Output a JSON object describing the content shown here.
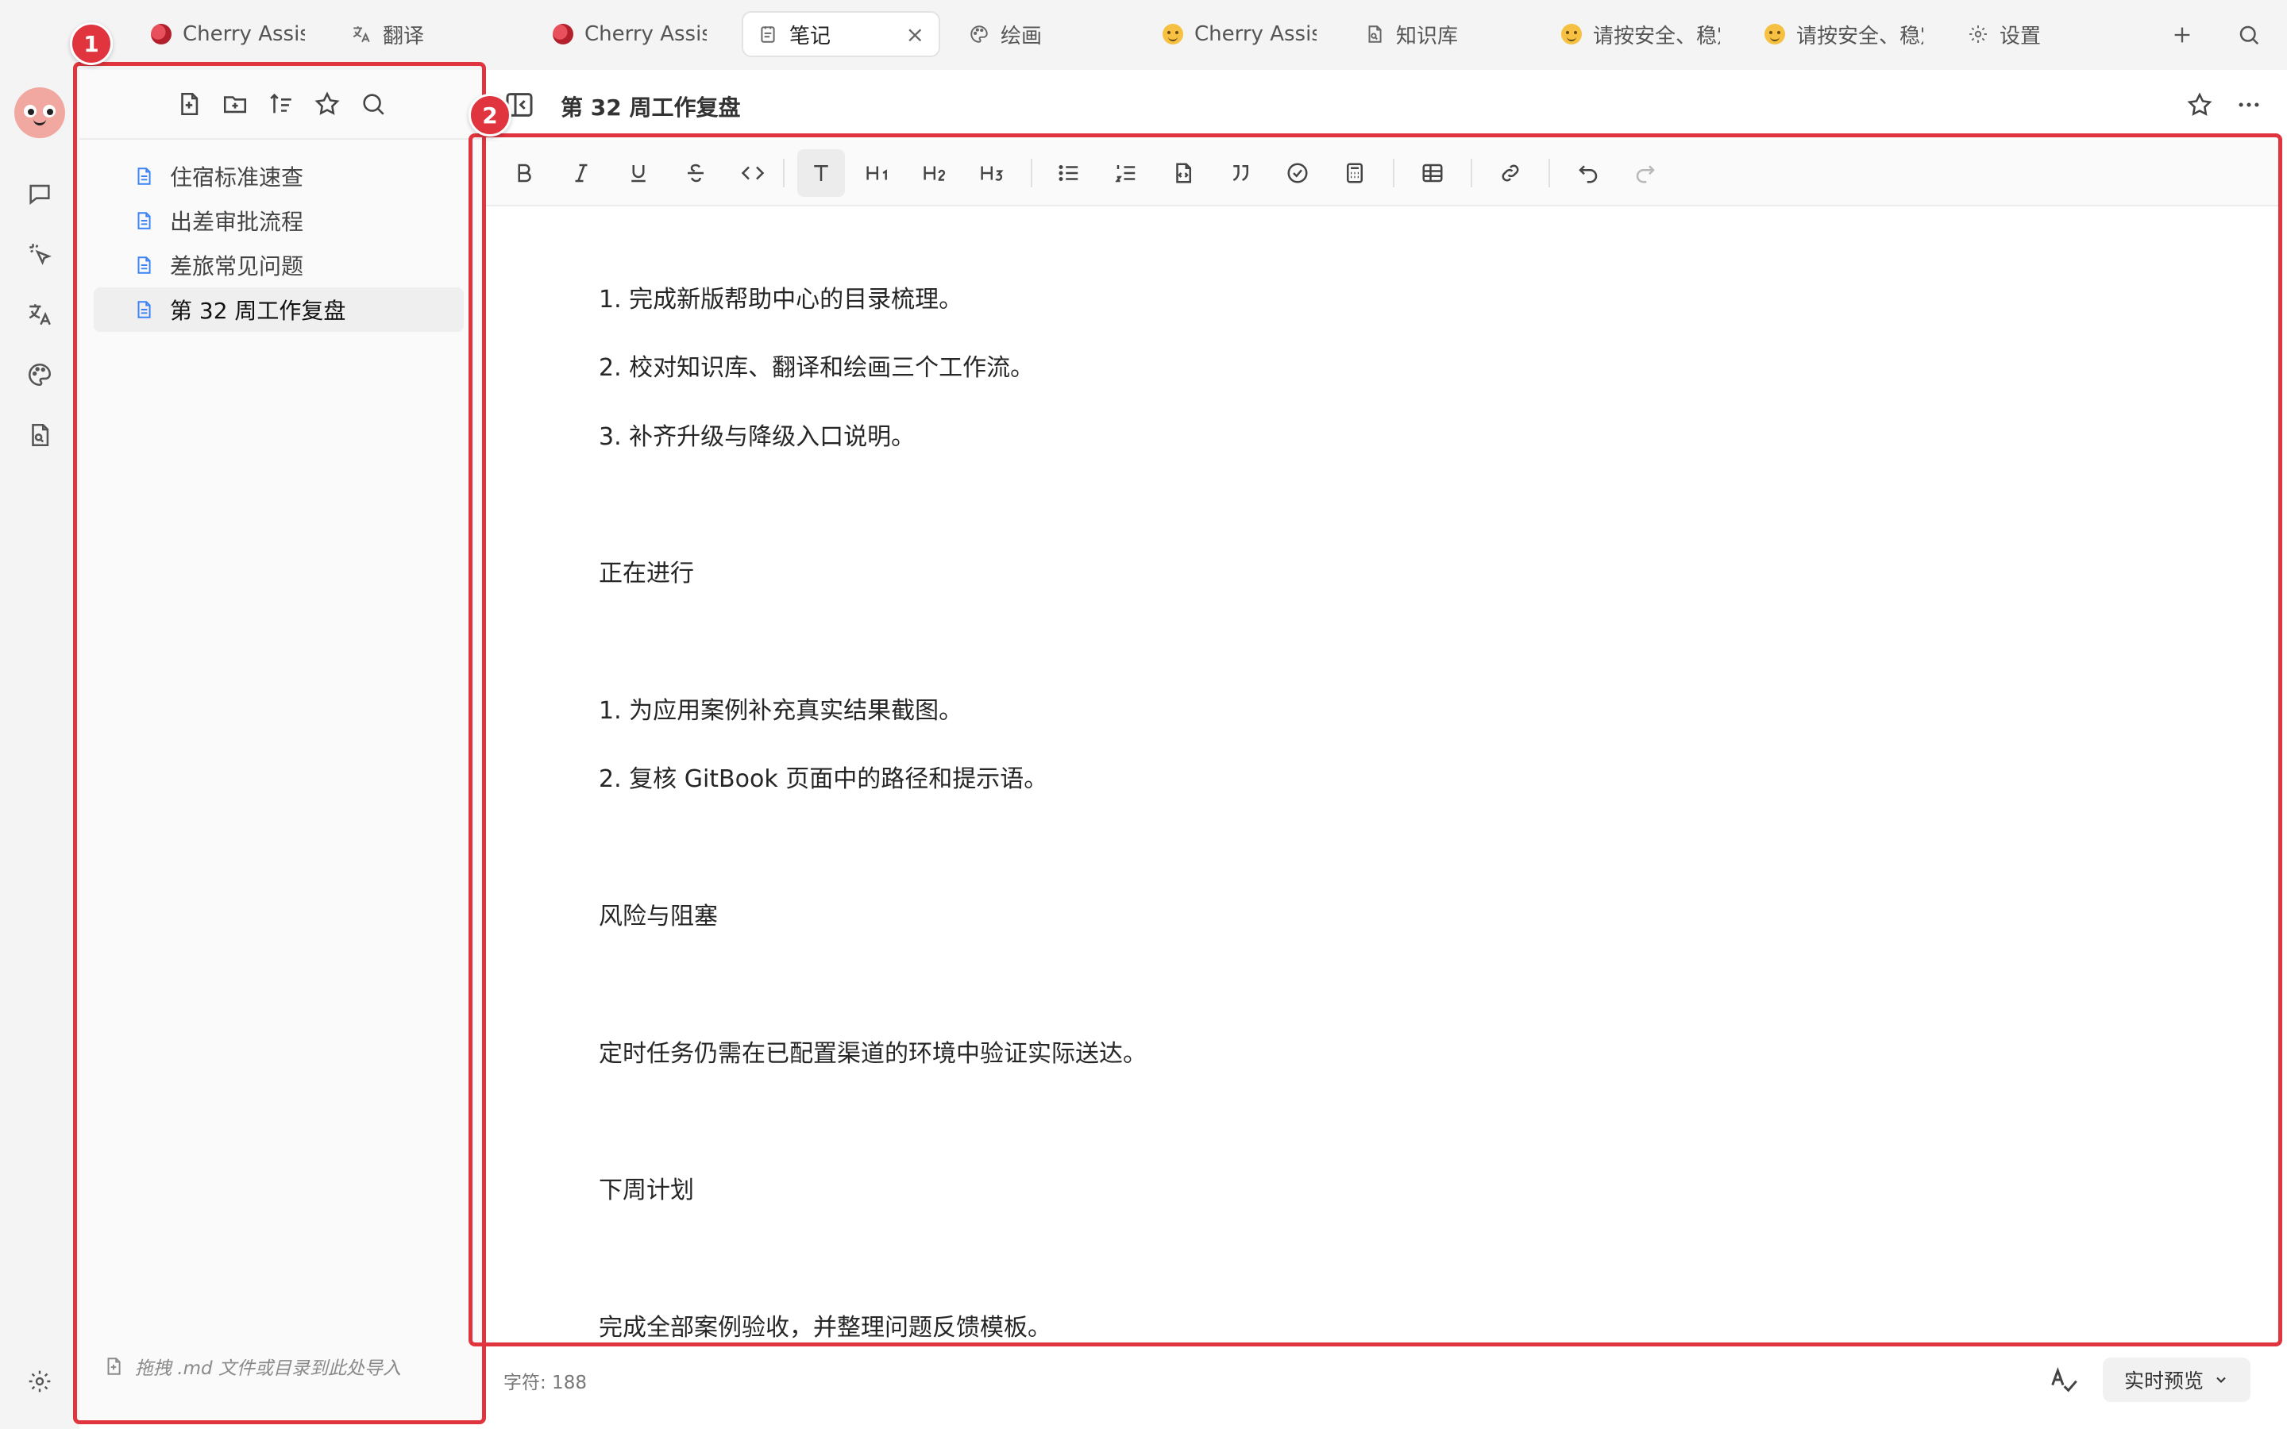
{
  "tabs": [
    {
      "label": "Cherry Assista",
      "icon": "cherry-emoji"
    },
    {
      "label": "翻译",
      "icon": "translate-icon"
    },
    {
      "label": "Cherry Assista",
      "icon": "cherry-emoji"
    },
    {
      "label": "笔记",
      "icon": "notes-icon",
      "active": true
    },
    {
      "label": "绘画",
      "icon": "palette-icon"
    },
    {
      "label": "Cherry Assista",
      "icon": "smiley-emoji"
    },
    {
      "label": "知识库",
      "icon": "knowledge-file-icon"
    },
    {
      "label": "请按安全、稳定",
      "icon": "smiley-emoji"
    },
    {
      "label": "请按安全、稳定",
      "icon": "smiley-emoji"
    },
    {
      "label": "设置",
      "icon": "gear-icon"
    }
  ],
  "notes": {
    "items": [
      {
        "label": "住宿标准速查"
      },
      {
        "label": "出差审批流程"
      },
      {
        "label": "差旅常见问题"
      },
      {
        "label": "第 32 周工作复盘",
        "active": true
      }
    ],
    "import_hint": "拖拽 .md 文件或目录到此处导入"
  },
  "editor": {
    "title": "第 32 周工作复盘",
    "lines": [
      "1. 完成新版帮助中心的目录梳理。",
      "2. 校对知识库、翻译和绘画三个工作流。",
      "3. 补齐升级与降级入口说明。",
      "正在进行",
      "1. 为应用案例补充真实结果截图。",
      "2. 复核 GitBook 页面中的路径和提示语。",
      "风险与阻塞",
      "定时任务仍需在已配置渠道的环境中验证实际送达。",
      "下周计划",
      "完成全部案例验收，并整理问题反馈模板。"
    ],
    "char_count": "字符: 188",
    "preview_mode": "实时预览"
  },
  "annotations": [
    "1",
    "2"
  ],
  "colors": {
    "accent_red": "#e0343f",
    "file_icon_blue": "#3b82f6"
  }
}
